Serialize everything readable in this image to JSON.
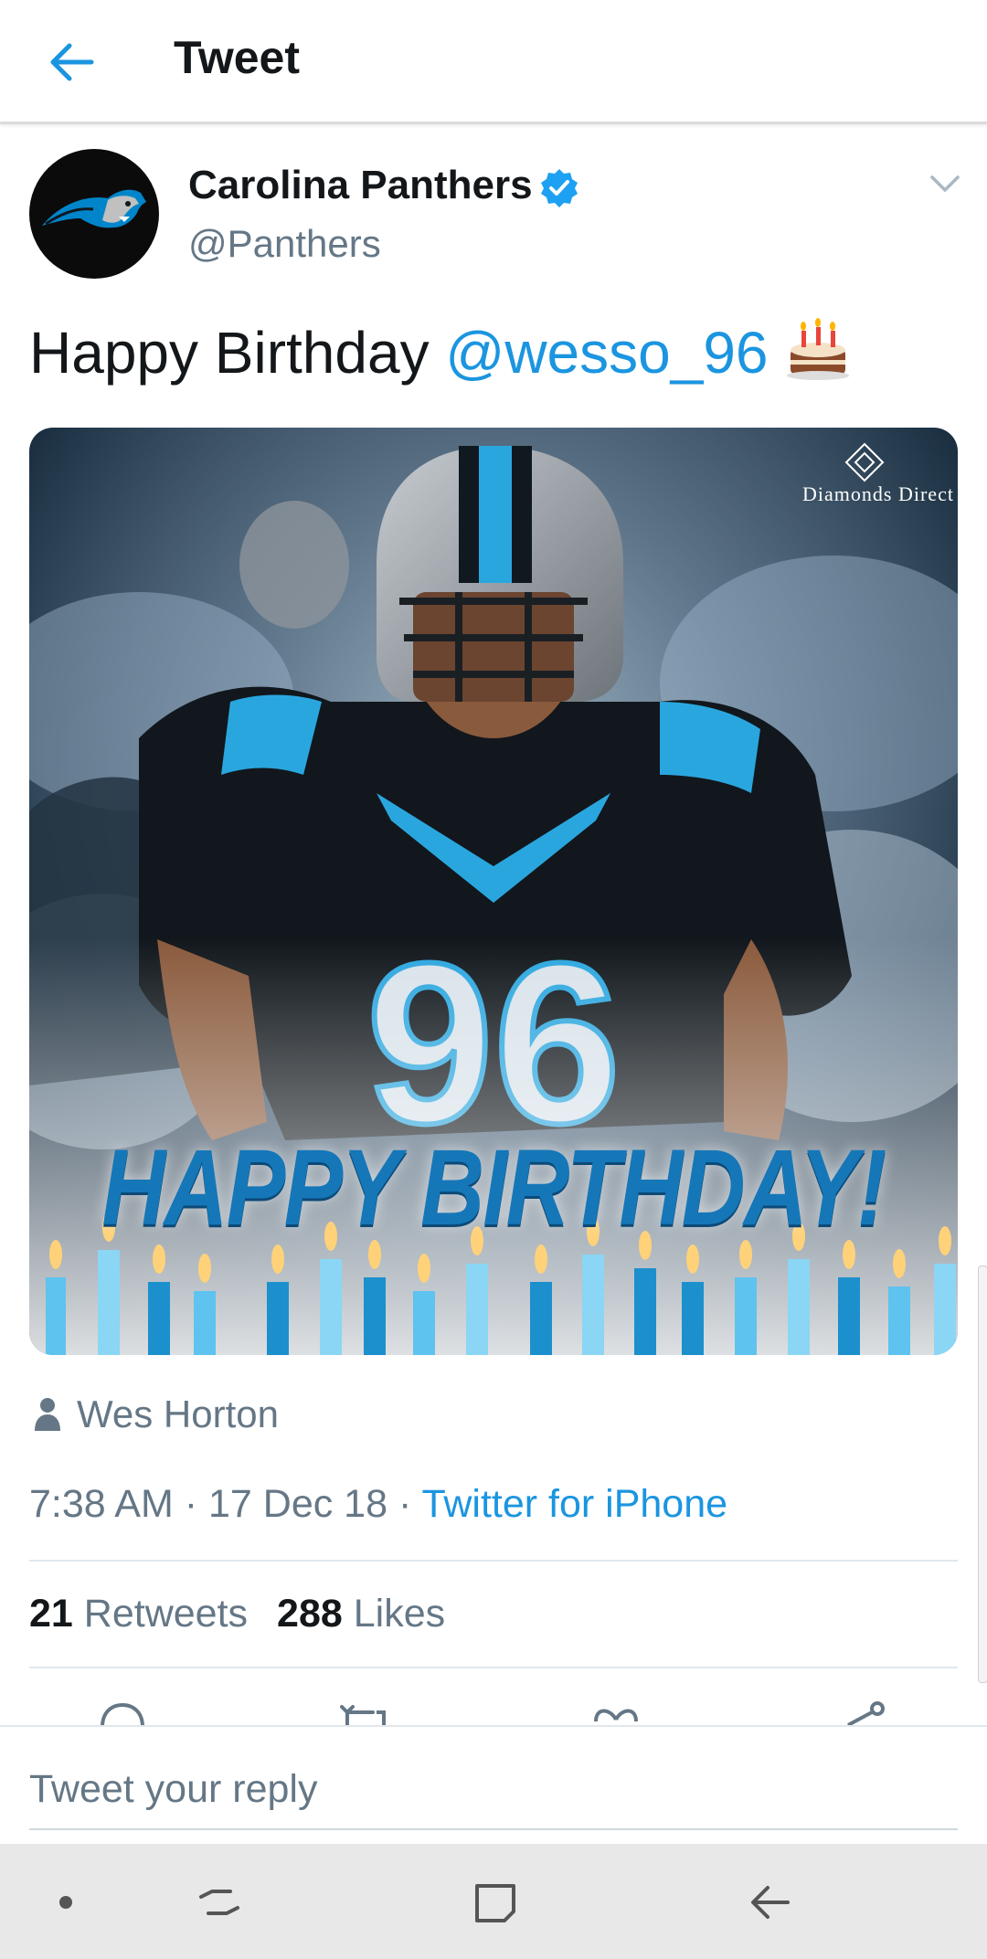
{
  "header": {
    "title": "Tweet",
    "back_icon": "arrow-left-icon"
  },
  "author": {
    "name": "Carolina Panthers",
    "handle": "@Panthers",
    "verified": true,
    "avatar_icon": "panther-logo"
  },
  "tweet": {
    "text": "Happy Birthday ",
    "mention": "@wesso_96",
    "emoji": "birthday-cake",
    "media": {
      "sponsor": "Diamonds Direct",
      "banner": "HAPPY BIRTHDAY!",
      "jersey_number": "96"
    },
    "tagged_user": "Wes Horton",
    "time": "7:38 AM",
    "date": "17 Dec 18",
    "separator": " · ",
    "source": "Twitter for iPhone"
  },
  "stats": {
    "retweets_count": "21",
    "retweets_label": " Retweets",
    "likes_count": "288",
    "likes_label": " Likes"
  },
  "actions": [
    {
      "icon": "reply-icon"
    },
    {
      "icon": "retweet-icon"
    },
    {
      "icon": "heart-icon"
    },
    {
      "icon": "share-icon"
    }
  ],
  "reply": {
    "placeholder": "Tweet your reply"
  },
  "nav_bar": {
    "icons": [
      "dot-icon",
      "recent-apps-icon",
      "home-icon",
      "back-icon"
    ]
  },
  "colors": {
    "accent": "#1b95e0",
    "text": "#14171a",
    "muted": "#657786",
    "divider": "#e1e8ed"
  }
}
